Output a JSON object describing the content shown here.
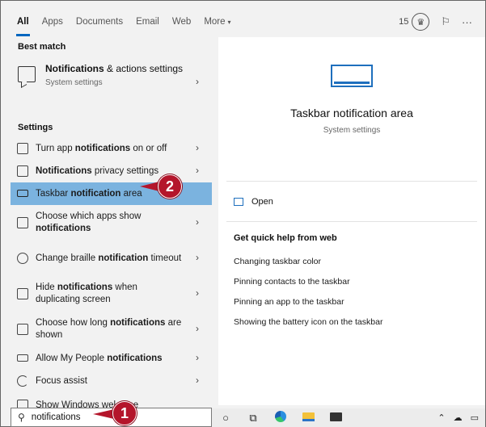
{
  "tabs": {
    "items": [
      "All",
      "Apps",
      "Documents",
      "Email",
      "Web",
      "More"
    ],
    "active": "All",
    "more_caret": "▾",
    "points": "15"
  },
  "left": {
    "best_match_heading": "Best match",
    "best_match": {
      "title_bold": "Notifications",
      "title_rest": " & actions settings",
      "subtitle": "System settings",
      "icon": "message-box-icon"
    },
    "settings_heading": "Settings",
    "rows": [
      {
        "pre": "Turn app ",
        "bold": "notifications",
        "post": " on or off",
        "icon": "message-box-icon"
      },
      {
        "pre": "",
        "bold": "Notifications",
        "post": " privacy settings",
        "icon": "message-box-icon"
      },
      {
        "pre": "Taskbar ",
        "bold": "notification",
        "post": " area",
        "icon": "monitor-icon",
        "selected": true
      },
      {
        "pre": "Choose which apps show ",
        "bold": "notifications",
        "post": "",
        "icon": "message-box-icon"
      },
      {
        "pre": "Change braille ",
        "bold": "notification",
        "post": " timeout",
        "icon": "braille-icon"
      },
      {
        "pre": "Hide ",
        "bold": "notifications",
        "post": " when duplicating screen",
        "icon": "message-box-icon"
      },
      {
        "pre": "Choose how long ",
        "bold": "notifications",
        "post": " are shown",
        "icon": "message-box-icon"
      },
      {
        "pre": "Allow My People ",
        "bold": "notifications",
        "post": "",
        "icon": "monitor-icon"
      },
      {
        "pre": "Focus assist",
        "bold": "",
        "post": "",
        "icon": "moon-icon"
      },
      {
        "pre": "Show Windows welcome",
        "bold": "",
        "post": "",
        "icon": "message-box-icon"
      }
    ],
    "chevron": "›"
  },
  "search": {
    "value": "notifications",
    "icon": "search-icon"
  },
  "preview": {
    "title": "Taskbar notification area",
    "subtitle": "System settings",
    "open_label": "Open",
    "web_heading": "Get quick help from web",
    "web_links": [
      "Changing taskbar color",
      "Pinning contacts to the taskbar",
      "Pinning an app to the taskbar",
      "Showing the battery icon on the taskbar"
    ]
  },
  "taskbar": {
    "icons": [
      "cortana-icon",
      "task-view-icon",
      "edge-icon",
      "file-explorer-icon",
      "mail-icon"
    ],
    "tray": [
      "chevron-up-icon",
      "cloud-icon",
      "network-icon"
    ]
  },
  "callouts": {
    "one": "1",
    "two": "2",
    "color": "#b4152b"
  },
  "colors": {
    "accent": "#0067c0",
    "selection": "#7bb3df"
  }
}
